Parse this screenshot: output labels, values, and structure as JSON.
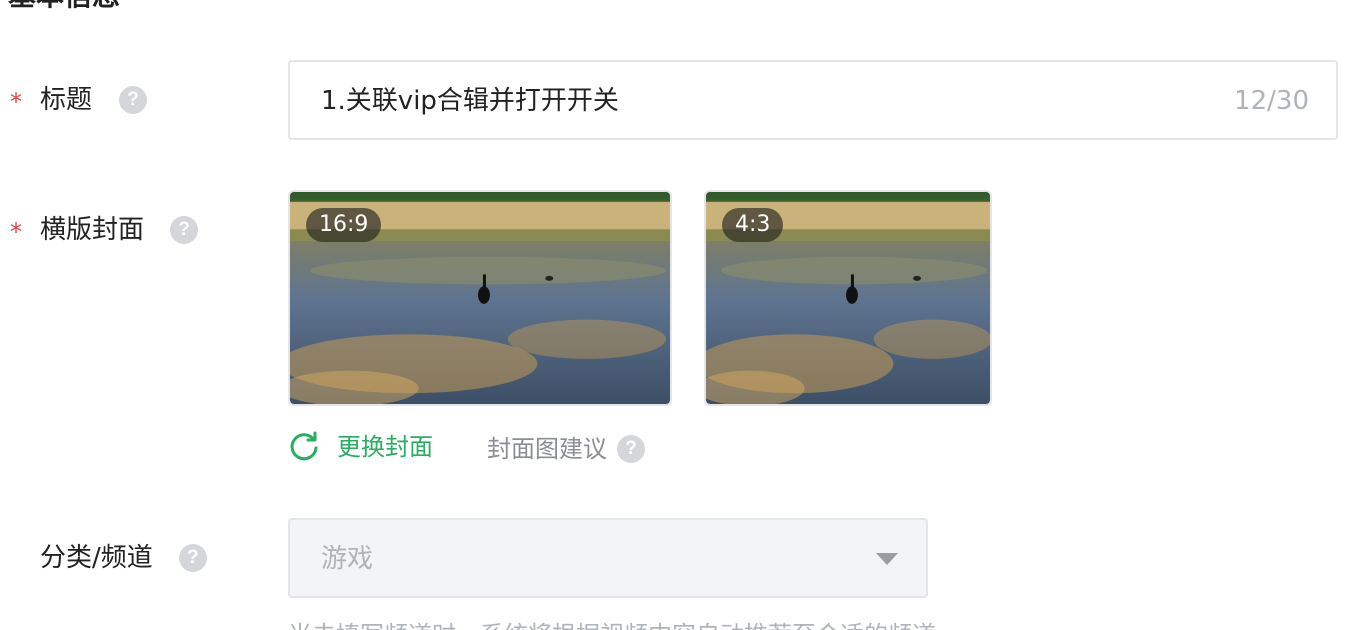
{
  "section": {
    "title": "基本信息"
  },
  "title_field": {
    "label": "标题",
    "help": "?",
    "value": "1.关联vip合辑并打开开关",
    "counter": "12/30"
  },
  "cover_field": {
    "label": "横版封面",
    "help": "?",
    "covers": [
      {
        "ratio": "16:9"
      },
      {
        "ratio": "4:3"
      }
    ],
    "change_label": "更换封面",
    "advice_label": "封面图建议",
    "advice_help": "?"
  },
  "category_field": {
    "label": "分类/频道",
    "help": "?",
    "selected": "游戏",
    "hint": "当未填写频道时，系统将根据视频内容自动推荐至合适的频道"
  },
  "colors": {
    "required": "#e84040",
    "accent": "#27ae60",
    "border": "#e3e5e8",
    "muted_text": "#b0b3b8"
  }
}
